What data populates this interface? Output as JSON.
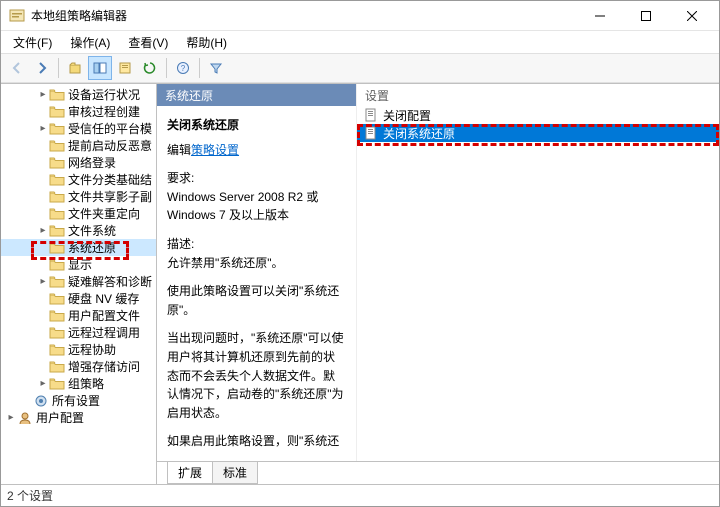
{
  "titlebar": {
    "title": "本地组策略编辑器"
  },
  "menu": {
    "file": "文件(F)",
    "action": "操作(A)",
    "view": "查看(V)",
    "help": "帮助(H)"
  },
  "tree": {
    "items": [
      {
        "indent": 3,
        "label": "设备运行状况",
        "exp": "▸"
      },
      {
        "indent": 3,
        "label": "审核过程创建",
        "exp": ""
      },
      {
        "indent": 3,
        "label": "受信任的平台模",
        "exp": "▸"
      },
      {
        "indent": 3,
        "label": "提前启动反恶意",
        "exp": ""
      },
      {
        "indent": 3,
        "label": "网络登录",
        "exp": ""
      },
      {
        "indent": 3,
        "label": "文件分类基础结",
        "exp": ""
      },
      {
        "indent": 3,
        "label": "文件共享影子副",
        "exp": ""
      },
      {
        "indent": 3,
        "label": "文件夹重定向",
        "exp": ""
      },
      {
        "indent": 3,
        "label": "文件系统",
        "exp": "▸"
      },
      {
        "indent": 3,
        "label": "系统还原",
        "exp": "",
        "selected": true
      },
      {
        "indent": 3,
        "label": "显示",
        "exp": ""
      },
      {
        "indent": 3,
        "label": "疑难解答和诊断",
        "exp": "▸"
      },
      {
        "indent": 3,
        "label": "硬盘 NV 缓存",
        "exp": ""
      },
      {
        "indent": 3,
        "label": "用户配置文件",
        "exp": ""
      },
      {
        "indent": 3,
        "label": "远程过程调用",
        "exp": ""
      },
      {
        "indent": 3,
        "label": "远程协助",
        "exp": ""
      },
      {
        "indent": 3,
        "label": "增强存储访问",
        "exp": ""
      },
      {
        "indent": 3,
        "label": "组策略",
        "exp": "▸"
      }
    ],
    "all_settings": "所有设置",
    "user_config": "用户配置"
  },
  "desc": {
    "header": "系统还原",
    "title": "关闭系统还原",
    "edit_prefix": "编辑",
    "edit_link": "策略设置",
    "req_label": "要求:",
    "req_text": "Windows Server 2008 R2 或 Windows 7 及以上版本",
    "desc_label": "描述:",
    "desc_text1": "允许禁用\"系统还原\"。",
    "desc_text2": "使用此策略设置可以关闭\"系统还原\"。",
    "desc_text3": "当出现问题时，\"系统还原\"可以使用户将其计算机还原到先前的状态而不会丢失个人数据文件。默认情况下，启动卷的\"系统还原\"为启用状态。",
    "desc_text4": "如果启用此策略设置，则\"系统还"
  },
  "list": {
    "col": "设置",
    "rows": [
      {
        "label": "关闭配置",
        "selected": false
      },
      {
        "label": "关闭系统还原",
        "selected": true
      }
    ]
  },
  "tabs": {
    "extended": "扩展",
    "standard": "标准"
  },
  "status": {
    "text": "2 个设置"
  }
}
